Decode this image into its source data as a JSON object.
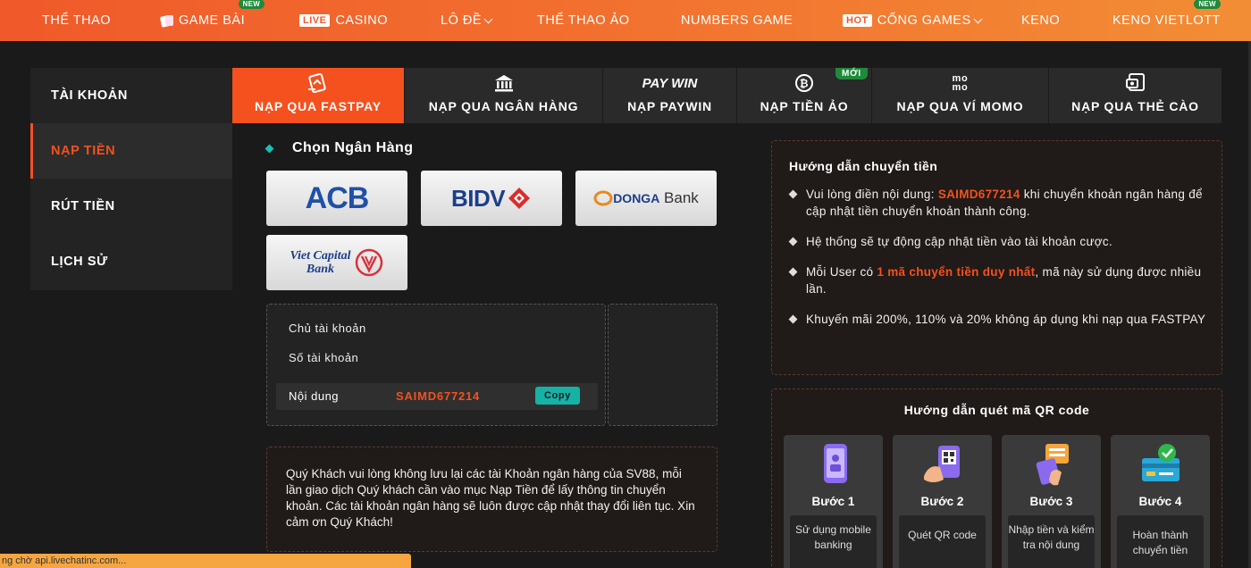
{
  "topnav": {
    "items": [
      {
        "label": "THỂ THAO"
      },
      {
        "label": "GAME BÀI",
        "badge": "NEW"
      },
      {
        "label": "CASINO",
        "tag": "LIVE"
      },
      {
        "label": "LÔ ĐỀ"
      },
      {
        "label": "THỂ THAO ẢO"
      },
      {
        "label": "NUMBERS GAME"
      },
      {
        "label": "CỔNG GAMES",
        "tag": "HOT"
      },
      {
        "label": "KENO"
      },
      {
        "label": "KENO VIETLOTT",
        "badge": "NEW"
      }
    ]
  },
  "sidebar": {
    "items": [
      {
        "label": "TÀI KHOẢN"
      },
      {
        "label": "NẠP TIỀN"
      },
      {
        "label": "RÚT TIỀN"
      },
      {
        "label": "LỊCH SỬ"
      }
    ]
  },
  "tabs": {
    "items": [
      {
        "label": "NẠP QUA FASTPAY"
      },
      {
        "label": "NẠP QUA NGÂN HÀNG"
      },
      {
        "label": "NẠP PAYWIN",
        "logo": "PAY WIN"
      },
      {
        "label": "NẠP TIỀN ẢO",
        "badge": "MỚI"
      },
      {
        "label": "NẠP QUA VÍ MOMO",
        "logo": "mo mo"
      },
      {
        "label": "NẠP QUA THẺ CÀO"
      }
    ]
  },
  "bank_select": {
    "title": "Chọn Ngân Hàng",
    "banks": [
      {
        "name": "ACB"
      },
      {
        "name": "BIDV"
      },
      {
        "name": "DONGA",
        "suffix": "Bank"
      },
      {
        "name": "Viet Capital",
        "suffix": "Bank"
      }
    ]
  },
  "account": {
    "owner_label": "Chủ tài khoản",
    "number_label": "Số tài khoản",
    "content_label": "Nội dung",
    "content_value": "SAIMD677214",
    "copy_label": "Copy"
  },
  "note": {
    "text": "Quý Khách vui lòng không lưu lại các tài Khoản ngân hàng của SV88, mỗi lần giao dịch Quý khách cần vào mục Nạp Tiền để lấy thông tin chuyển khoản. Các tài khoản ngân hàng sẽ luôn được cập nhật thay đổi liên tục. Xin cảm ơn Quý Khách!"
  },
  "guide": {
    "title": "Hướng dẫn chuyển tiền",
    "item1_pre": "Vui lòng điền nội dung: ",
    "item1_code": "SAIMD677214",
    "item1_post": " khi chuyển khoản ngân hàng để cập nhật tiền chuyển khoản thành công.",
    "item2": "Hệ thống sẽ tự động cập nhật tiền vào tài khoản cược.",
    "item3_pre": "Mỗi User có ",
    "item3_hl": "1 mã chuyển tiền duy nhất",
    "item3_post": ", mã này sử dụng được nhiều lần.",
    "item4": "Khuyến mãi 200%, 110% và 20% không áp dụng khi nạp qua FASTPAY"
  },
  "qr_guide": {
    "title": "Hướng dẫn quét mã QR code",
    "steps": [
      {
        "title": "Bước 1",
        "desc": "Sử dụng mobile banking"
      },
      {
        "title": "Bước 2",
        "desc": "Quét QR code"
      },
      {
        "title": "Bước 3",
        "desc": "Nhập tiền và kiểm tra nội dung"
      },
      {
        "title": "Bước 4",
        "desc": "Hoàn thành chuyển tiền"
      }
    ]
  },
  "status_bar": {
    "text": "ng chờ api.livechatinc.com..."
  },
  "colors": {
    "accent": "#f4511e",
    "teal": "#17c1b3",
    "nav_start": "#f0592a",
    "nav_end": "#f28d35"
  }
}
